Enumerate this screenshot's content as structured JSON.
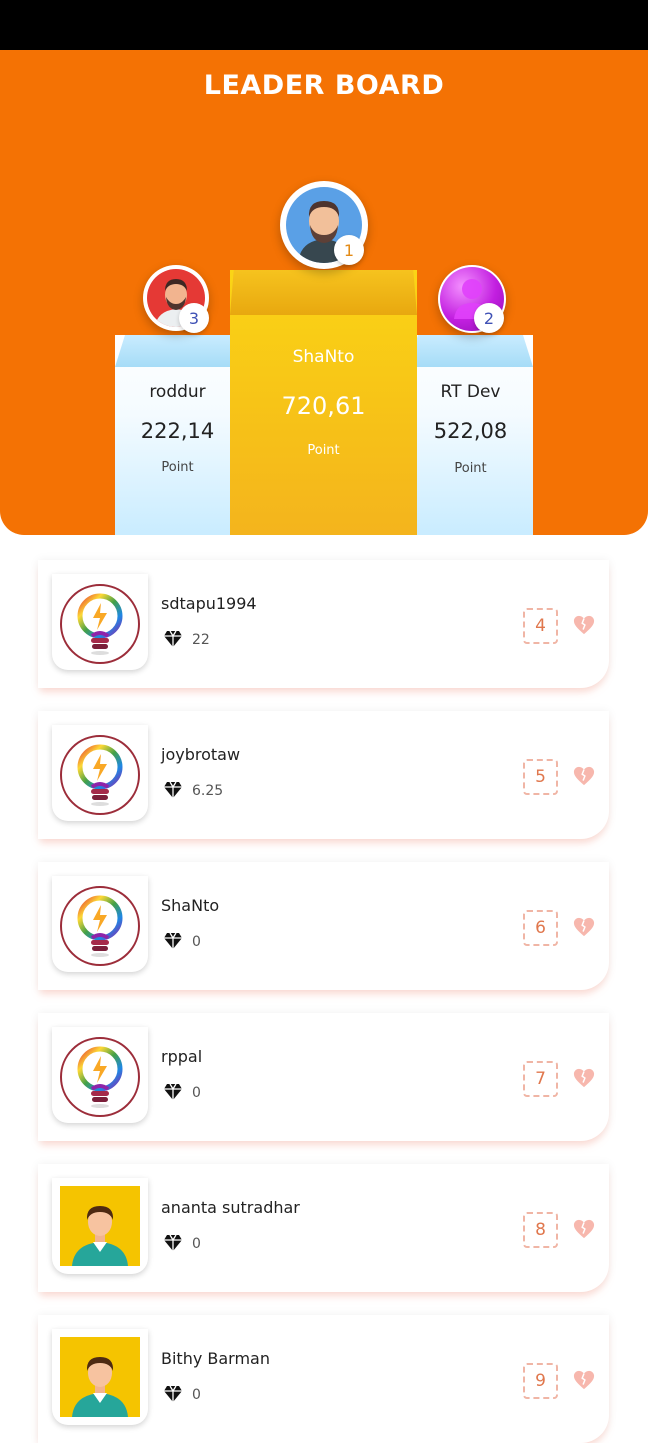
{
  "header": {
    "title": "LEADER BOARD"
  },
  "podium": [
    {
      "rank": "1",
      "name": "ShaNto",
      "score": "720,61",
      "unit": "Point"
    },
    {
      "rank": "2",
      "name": "RT Dev",
      "score": "522,08",
      "unit": "Point"
    },
    {
      "rank": "3",
      "name": "roddur",
      "score": "222,14",
      "unit": "Point"
    }
  ],
  "list": [
    {
      "rank": "4",
      "name": "sdtapu1994",
      "points": "22",
      "avatar": "bulb-icon"
    },
    {
      "rank": "5",
      "name": "joybrotaw",
      "points": "6.25",
      "avatar": "bulb-icon"
    },
    {
      "rank": "6",
      "name": "ShaNto",
      "points": "0",
      "avatar": "bulb-icon"
    },
    {
      "rank": "7",
      "name": "rppal",
      "points": "0",
      "avatar": "bulb-icon"
    },
    {
      "rank": "8",
      "name": "ananta sutradhar",
      "points": "0",
      "avatar": "person-icon"
    },
    {
      "rank": "9",
      "name": "Bithy Barman",
      "points": "0",
      "avatar": "person-icon"
    }
  ],
  "colors": {
    "header": "#f47204",
    "gold": "#f7c417",
    "rank_accent": "#e0774d"
  }
}
